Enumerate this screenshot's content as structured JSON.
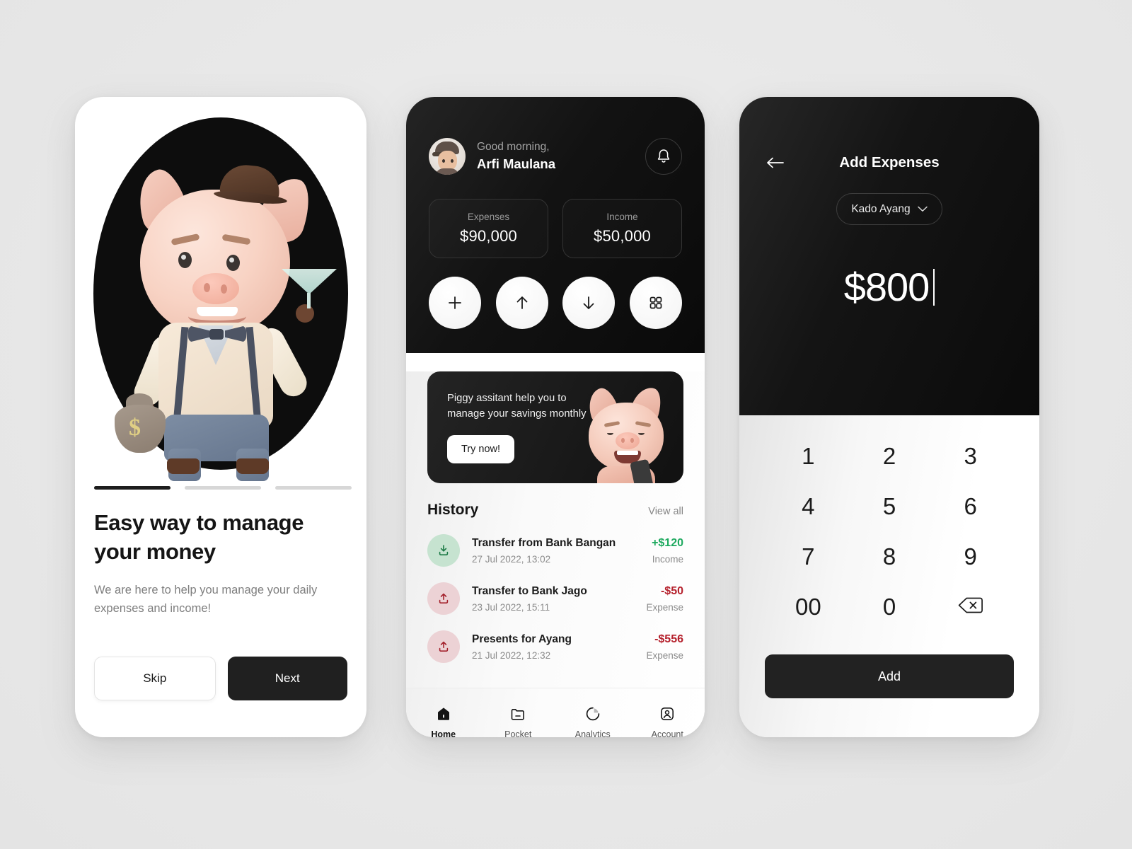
{
  "onboarding": {
    "illustration": "pig-mascot-illustration",
    "pagination": [
      {
        "state": "active"
      },
      {
        "state": "inactive"
      },
      {
        "state": "inactive"
      }
    ],
    "title": "Easy way to manage your money",
    "subtitle": "We are here to help you manage your daily expenses and income!",
    "skip_label": "Skip",
    "next_label": "Next"
  },
  "home": {
    "greeting": "Good morning,",
    "user_name": "Arfi Maulana",
    "avatar": "user-avatar",
    "bell_icon": "bell-icon",
    "stats": [
      {
        "label": "Expenses",
        "value": "$90,000"
      },
      {
        "label": "Income",
        "value": "$50,000"
      }
    ],
    "quick_actions": [
      {
        "icon": "plus-icon",
        "name": "add"
      },
      {
        "icon": "arrow-up-icon",
        "name": "send"
      },
      {
        "icon": "arrow-down-icon",
        "name": "receive"
      },
      {
        "icon": "grid-icon",
        "name": "more"
      }
    ],
    "promo": {
      "text": "Piggy assitant help you to manage your savings monthly",
      "button_label": "Try now!",
      "art": "piggy-with-phone"
    },
    "history": {
      "title": "History",
      "view_all_label": "View all",
      "transactions": [
        {
          "name": "Transfer from Bank Bangan",
          "date": "27 Jul 2022, 13:02",
          "amount": "+$120",
          "type": "Income",
          "direction": "in",
          "icon": "download-arrow-icon"
        },
        {
          "name": "Transfer to Bank Jago",
          "date": "23 Jul 2022, 15:11",
          "amount": "-$50",
          "type": "Expense",
          "direction": "out",
          "icon": "upload-arrow-icon"
        },
        {
          "name": "Presents for Ayang",
          "date": "21 Jul 2022, 12:32",
          "amount": "-$556",
          "type": "Expense",
          "direction": "out",
          "icon": "upload-arrow-icon"
        }
      ]
    },
    "tabs": [
      {
        "label": "Home",
        "icon": "home-icon",
        "active": true
      },
      {
        "label": "Pocket",
        "icon": "folder-icon",
        "active": false
      },
      {
        "label": "Analytics",
        "icon": "pie-chart-icon",
        "active": false
      },
      {
        "label": "Account",
        "icon": "person-icon",
        "active": false
      }
    ]
  },
  "add_expense": {
    "back_icon": "arrow-left-icon",
    "title": "Add Expenses",
    "category": "Kado Ayang",
    "category_chevron": "chevron-down-icon",
    "amount": "$800",
    "keys": [
      "1",
      "2",
      "3",
      "4",
      "5",
      "6",
      "7",
      "8",
      "9",
      "00",
      "0"
    ],
    "backspace_icon": "backspace-icon",
    "submit_label": "Add"
  },
  "colors": {
    "background": "#e9e9e9",
    "dark": "#111111",
    "income_green": "#1da95e",
    "expense_red": "#b5202c",
    "income_chip": "#c6e3d0",
    "expense_chip": "#ecd2d5"
  }
}
